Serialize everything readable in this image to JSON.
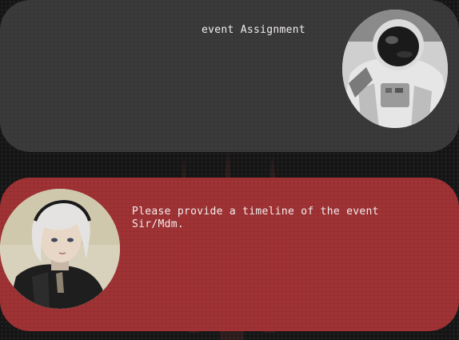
{
  "messages": [
    {
      "role": "system",
      "text": "event Assignment",
      "avatar_icon": "astronaut-avatar-icon"
    },
    {
      "role": "user",
      "text": "Please provide a timeline of the event Sir/Mdm.",
      "avatar_icon": "android-girl-avatar-icon"
    }
  ],
  "colors": {
    "background": "#151515",
    "system_bubble": "#3a3a3a",
    "user_bubble": "#a83436",
    "text": "#f2eded"
  }
}
